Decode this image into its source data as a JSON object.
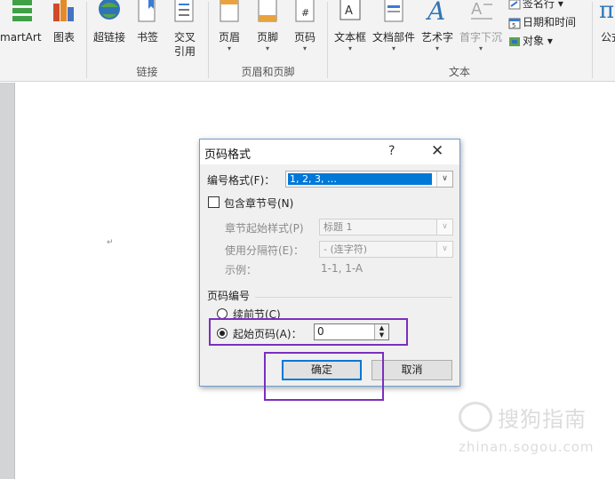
{
  "ribbon": {
    "buttons": {
      "smartart": "martArt",
      "chart": "图表",
      "hyperlink": "超链接",
      "bookmark": "书签",
      "crossref_line1": "交叉",
      "crossref_line2": "引用",
      "header": "页眉",
      "footer": "页脚",
      "page_number": "页码",
      "textbox": "文本框",
      "quick_parts": "文档部件",
      "wordart": "艺术字",
      "dropcap": "首字下沉",
      "signature": "签名行",
      "datetime": "日期和时间",
      "object": "对象",
      "equation": "公式"
    },
    "groups": {
      "links": "链接",
      "header_footer": "页眉和页脚",
      "text": "文本"
    }
  },
  "document": {
    "paragraph_mark": "↵"
  },
  "dialog": {
    "title": "页码格式",
    "help": "?",
    "close": "✕",
    "number_format_label": "编号格式(F)：",
    "number_format_value": "1, 2, 3, …",
    "include_chapter_label": "包含章节号(N)",
    "chapter_style_label": "章节起始样式(P)",
    "chapter_style_value": "标题 1",
    "separator_label": "使用分隔符(E)：",
    "separator_value": "-  (连字符)",
    "example_label": "示例：",
    "example_value": "1-1, 1-A",
    "page_numbering_label": "页码编号",
    "continue_label": "续前节(C)",
    "start_at_label": "起始页码(A)：",
    "start_at_value": "0",
    "ok": "确定",
    "cancel": "取消"
  },
  "colors": {
    "highlight": "#7a2fbf",
    "selection": "#0078d7",
    "dialog_border": "#6e9fd4"
  },
  "watermark": {
    "line1": "搜狗指南",
    "line2": "zhinan.sogou.com"
  }
}
